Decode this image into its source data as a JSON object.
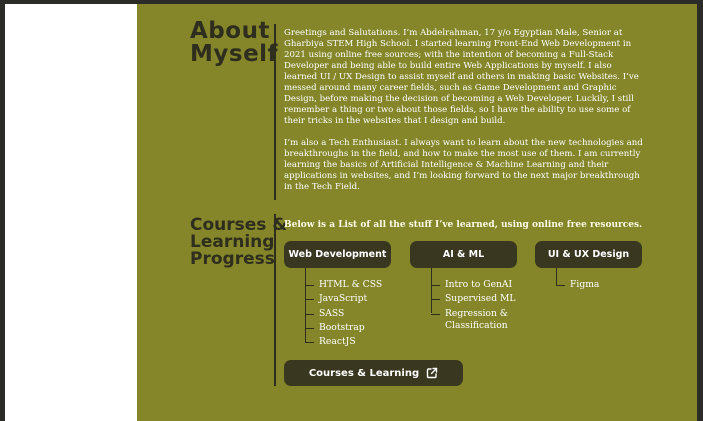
{
  "about": {
    "title_line1": "About",
    "title_line2": "Myself",
    "paragraph1": "Greetings and Salutations. I’m Abdelrahman, 17 y/o Egyptian Male, Senior at Gharbiya STEM High School. I started learning Front-End Web Development in 2021 using online free sources; with the intention of becoming a Full-Stack Developer and being able to build entire Web Applications by myself. I also learned UI / UX Design to assist myself and others in making basic Websites. I’ve messed around many career fields, such as Game Development and Graphic Design, before making the decision of becoming a Web Developer. Luckily, I still remember a thing or two about those fields, so I have the ability to use some of their tricks in the websites that I design and build.",
    "paragraph2": "I’m also a Tech Enthusiast. I always want to learn about the new technologies and breakthroughs in the field, and how to make the most use of them. I am currently learning the basics of Artificial Intelligence & Machine Learning and their applications in websites, and I’m looking forward to the next major breakthrough in the Tech Field."
  },
  "courses": {
    "title_line1": "Courses &",
    "title_line2": "Learning",
    "title_line3": "Progress",
    "intro": "Below is a List of all the stuff I’ve learned, using online free resources.",
    "categories": [
      {
        "label": "Web Development",
        "items": [
          "HTML & CSS",
          "JavaScript",
          "SASS",
          "Bootstrap",
          "ReactJS"
        ]
      },
      {
        "label": "AI & ML",
        "items": [
          "Intro to GenAI",
          "Supervised ML",
          "Regression & Classification"
        ]
      },
      {
        "label": "UI & UX Design",
        "items": [
          "Figma"
        ]
      }
    ],
    "button_label": "Courses & Learning",
    "button_icon": "external-link-icon"
  },
  "colors": {
    "panel": "#85862a",
    "dark": "#393720",
    "title": "#2f2e1e"
  }
}
